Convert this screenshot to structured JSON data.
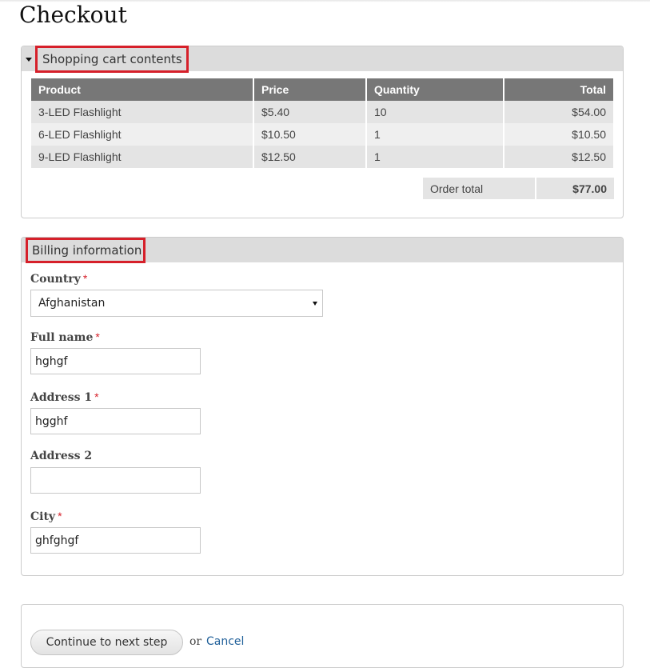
{
  "page": {
    "title": "Checkout"
  },
  "cart": {
    "legend": "Shopping cart contents",
    "columns": [
      "Product",
      "Price",
      "Quantity",
      "Total"
    ],
    "rows": [
      {
        "product": "3-LED Flashlight",
        "price": "$5.40",
        "quantity": "10",
        "total": "$54.00"
      },
      {
        "product": "6-LED Flashlight",
        "price": "$10.50",
        "quantity": "1",
        "total": "$10.50"
      },
      {
        "product": "9-LED Flashlight",
        "price": "$12.50",
        "quantity": "1",
        "total": "$12.50"
      }
    ],
    "order_total_label": "Order total",
    "order_total_value": "$77.00"
  },
  "billing": {
    "legend": "Billing information",
    "required_marker": "*",
    "country": {
      "label": "Country",
      "selected": "Afghanistan"
    },
    "full_name": {
      "label": "Full name",
      "value": "hghgf"
    },
    "address1": {
      "label": "Address 1",
      "value": "hgghf"
    },
    "address2": {
      "label": "Address 2",
      "value": ""
    },
    "city": {
      "label": "City",
      "value": "ghfghgf"
    }
  },
  "actions": {
    "continue_label": "Continue to next step",
    "or_text": "or",
    "cancel_label": "Cancel"
  },
  "colors": {
    "highlight": "#d6202a",
    "table_header": "#777777",
    "link": "#1f5f99"
  }
}
